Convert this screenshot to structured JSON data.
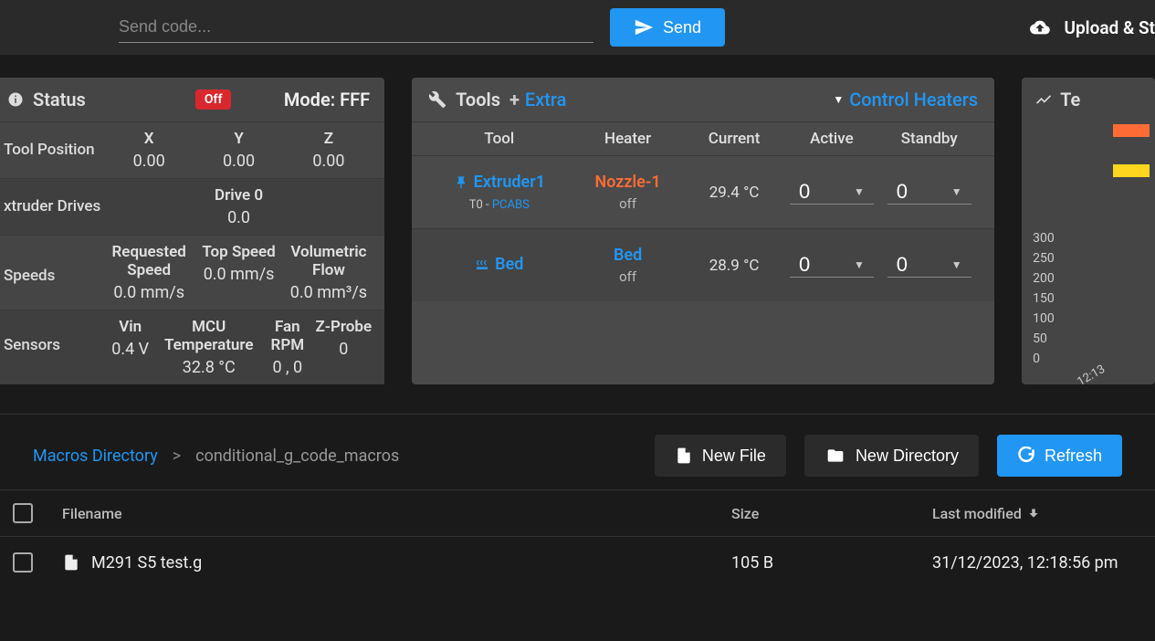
{
  "topbar": {
    "code_placeholder": "Send code...",
    "send_label": "Send",
    "upload_label": "Upload & St"
  },
  "status": {
    "heading": "Status",
    "badge": "Off",
    "mode": "Mode: FFF",
    "tool_position_label": "Tool Position",
    "axes": {
      "x_h": "X",
      "x_v": "0.00",
      "y_h": "Y",
      "y_v": "0.00",
      "z_h": "Z",
      "z_v": "0.00"
    },
    "extruder_drives_label": "xtruder Drives",
    "drive0_h": "Drive 0",
    "drive0_v": "0.0",
    "speeds_label": "Speeds",
    "req_h": "Requested Speed",
    "req_v": "0.0 mm/s",
    "top_h": "Top Speed",
    "top_v": "0.0 mm/s",
    "vol_h": "Volumetric Flow",
    "vol_v": "0.0 mm³/s",
    "sensors_label": "Sensors",
    "vin_h": "Vin",
    "vin_v": "0.4 V",
    "mcu_h": "MCU Temperature",
    "mcu_v": "32.8 °C",
    "fan_h": "Fan RPM",
    "fan_v": "0 , 0",
    "zp_h": "Z-Probe",
    "zp_v": "0"
  },
  "tools": {
    "heading": "Tools",
    "extra_label": "Extra",
    "control_heaters": "Control Heaters",
    "col_tool": "Tool",
    "col_heater": "Heater",
    "col_current": "Current",
    "col_active": "Active",
    "col_standby": "Standby",
    "rows": [
      {
        "name": "Extruder1",
        "sub_prefix": "T0 - ",
        "material": "PCABS",
        "heater": "Nozzle-1",
        "heater_class": "nozzle",
        "state": "off",
        "current": "29.4 °C",
        "active": "0",
        "standby": "0"
      },
      {
        "name": "Bed",
        "sub_prefix": "",
        "material": "",
        "heater": "Bed",
        "heater_class": "bed",
        "state": "off",
        "current": "28.9 °C",
        "active": "0",
        "standby": "0"
      }
    ]
  },
  "temp_chart": {
    "heading": "Te",
    "y_ticks": [
      "300",
      "250",
      "200",
      "150",
      "100",
      "50",
      "0"
    ],
    "x_tick": "12:13",
    "legend_colors": [
      "#ff6b35",
      "#ffd61f"
    ]
  },
  "files": {
    "root_crumb": "Macros Directory",
    "current_crumb": "conditional_g_code_macros",
    "new_file": "New File",
    "new_dir": "New Directory",
    "refresh": "Refresh",
    "col_filename": "Filename",
    "col_size": "Size",
    "col_modified": "Last modified",
    "rows": [
      {
        "name": "M291 S5 test.g",
        "size": "105 B",
        "modified": "31/12/2023, 12:18:56 pm"
      }
    ]
  }
}
